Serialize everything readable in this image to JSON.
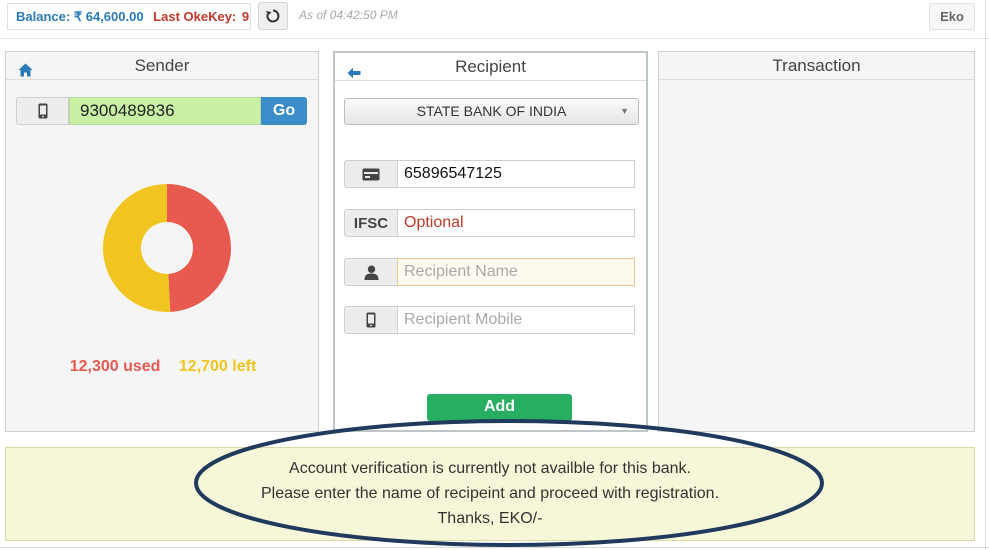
{
  "topbar": {
    "balance_label": "Balance:",
    "balance_value": "₹ 64,600.00",
    "okey_label": "Last OkeKey:",
    "okey_value": "9",
    "as_of": "As of 04:42:50 PM",
    "eko_label": "Eko"
  },
  "sender": {
    "title": "Sender",
    "phone": "9300489836",
    "go_label": "Go",
    "used_text": "12,300 used",
    "left_text": "12,700 left",
    "used_amount": 12300,
    "left_amount": 12700,
    "used_color": "#e85a4f",
    "left_color": "#f1c521"
  },
  "recipient": {
    "title": "Recipient",
    "bank": "STATE BANK OF INDIA",
    "account_number": "65896547125",
    "ifsc_label": "IFSC",
    "ifsc_value": "Optional",
    "name_placeholder": "Recipient Name",
    "mobile_placeholder": "Recipient Mobile",
    "add_label": "Add"
  },
  "transaction": {
    "title": "Transaction"
  },
  "notice": {
    "line1": "Account verification is currently not availble for this bank.",
    "line2": "Please enter the name of recipeint and proceed with registration.",
    "line3": "Thanks, EKO/-"
  },
  "icons": {
    "refresh": "refresh-icon",
    "home": "home-icon",
    "back": "back-arrow-icon",
    "mobile": "mobile-icon",
    "card": "credit-card-icon",
    "user": "user-icon"
  }
}
